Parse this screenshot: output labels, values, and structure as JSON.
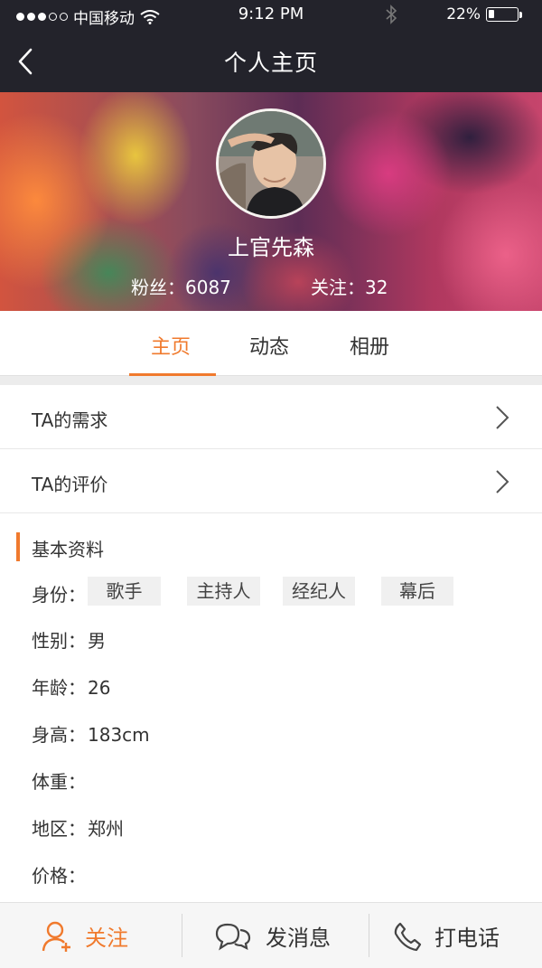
{
  "status_bar": {
    "carrier": "中国移动",
    "time": "9:12 PM",
    "battery": "22%",
    "battery_level": 0.22,
    "signal_dots_filled": 3,
    "signal_dots_total": 5
  },
  "nav": {
    "title": "个人主页",
    "back_icon": "chevron-left-icon"
  },
  "profile": {
    "name": "上官先森",
    "fans": "粉丝：6087",
    "following": "关注：32"
  },
  "tabs": [
    {
      "label": "主页",
      "active": true
    },
    {
      "label": "动态",
      "active": false
    },
    {
      "label": "相册",
      "active": false
    }
  ],
  "rows": [
    {
      "label": "TA的需求"
    },
    {
      "label": "TA的评价"
    }
  ],
  "basic_info": {
    "title": "基本资料",
    "identity_label": "身份：",
    "identity_tags": [
      "歌手",
      "主持人",
      "经纪人",
      "幕后"
    ],
    "gender_label": "性别：",
    "gender": "男",
    "age_label": "年龄：",
    "age": "26",
    "height_label": "身高：",
    "height": "183cm",
    "weight_label": "体重：",
    "weight": "",
    "region_label": "地区：",
    "region": "郑州",
    "price_label": "价格：",
    "price": ""
  },
  "bottom_bar": {
    "follow_label": "关注",
    "message_label": "发消息",
    "call_label": "打电话"
  },
  "colors": {
    "accent": "#f07a2d",
    "nav_bg": "#23232b",
    "bottom_bg": "#f6f6f6"
  }
}
